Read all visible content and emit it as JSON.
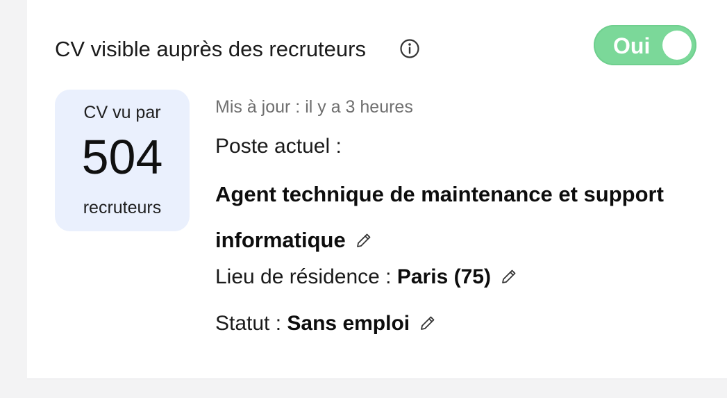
{
  "profile_visibility": {
    "label": "CV visible auprès des recruteurs",
    "info_icon": "info-circle-icon",
    "toggle": {
      "label": "Oui",
      "state": "on",
      "color": "#7bd899"
    }
  },
  "stats": {
    "caption_top": "CV vu par",
    "count": "504",
    "caption_bottom": "recruteurs",
    "background": "#eaf0fd"
  },
  "details": {
    "updated": "Mis à jour : il y a 3 heures",
    "current_position": {
      "label": "Poste actuel :",
      "value": "Agent technique de maintenance et support informatique",
      "edit_icon": "pencil-icon"
    },
    "residence": {
      "label": "Lieu de résidence :",
      "value": "Paris (75)",
      "edit_icon": "pencil-icon"
    },
    "status": {
      "label": "Statut :",
      "value": "Sans emploi",
      "edit_icon": "pencil-icon"
    }
  }
}
